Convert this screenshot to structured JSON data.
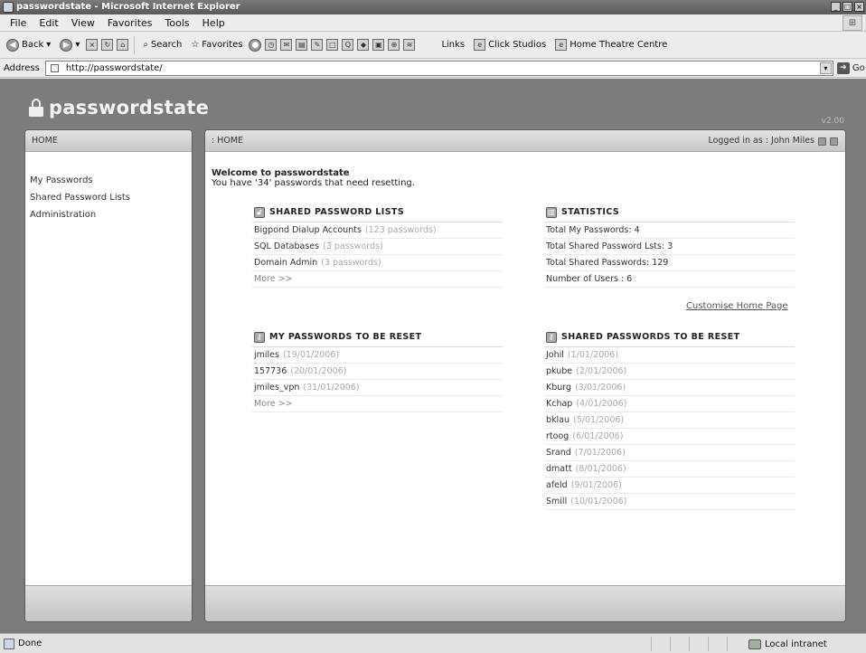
{
  "window": {
    "title": "passwordstate - Microsoft Internet Explorer",
    "controls": [
      "_",
      "□",
      "×"
    ]
  },
  "menu": [
    "File",
    "Edit",
    "View",
    "Favorites",
    "Tools",
    "Help"
  ],
  "toolbar": {
    "back": "Back",
    "search": "Search",
    "favorites": "Favorites",
    "links": "Links",
    "link1": "Click Studios",
    "link2": "Home Theatre Centre"
  },
  "address": {
    "label": "Address",
    "url": "http://passwordstate/",
    "go": "Go"
  },
  "app": {
    "brand": "passwordstate",
    "version": "v2.00"
  },
  "sidebar": {
    "header": "HOME",
    "items": [
      "My Passwords",
      "Shared Password Lists",
      "Administration"
    ]
  },
  "main": {
    "breadcrumb": ": HOME",
    "logged_in": "Logged in as : John Miles",
    "welcome_title": "Welcome to passwordstate",
    "welcome_text": "You have '34' passwords that need resetting.",
    "customise": "Customise Home Page",
    "more": "More >>"
  },
  "shared_lists": {
    "title": "SHARED PASSWORD LISTS",
    "items": [
      {
        "name": "Bigpond Dialup Accounts",
        "meta": "(123 passwords)"
      },
      {
        "name": "SQL Databases",
        "meta": "(3 passwords)"
      },
      {
        "name": "Domain Admin",
        "meta": "(3 passwords)"
      }
    ]
  },
  "statistics": {
    "title": "STATISTICS",
    "items": [
      "Total My Passwords: 4",
      "Total Shared Password Lsts: 3",
      "Total Shared Passwords: 129",
      "Number of Users : 6"
    ]
  },
  "my_reset": {
    "title": "MY PASSWORDS TO BE RESET",
    "items": [
      {
        "name": "jmiles",
        "date": "(19/01/2006)"
      },
      {
        "name": "157736",
        "date": "(20/01/2006)"
      },
      {
        "name": "jmiles_vpn",
        "date": "(31/01/2006)"
      }
    ]
  },
  "shared_reset": {
    "title": "SHARED PASSWORDS TO BE RESET",
    "items": [
      {
        "name": "Johil",
        "date": "(1/01/2006)"
      },
      {
        "name": "pkube",
        "date": "(2/01/2006)"
      },
      {
        "name": "Kburg",
        "date": "(3/01/2006)"
      },
      {
        "name": "Kchap",
        "date": "(4/01/2006)"
      },
      {
        "name": "bklau",
        "date": "(5/01/2006)"
      },
      {
        "name": "rtoog",
        "date": "(6/01/2006)"
      },
      {
        "name": "Srand",
        "date": "(7/01/2006)"
      },
      {
        "name": "dmatt",
        "date": "(8/01/2006)"
      },
      {
        "name": "afeld",
        "date": "(9/01/2006)"
      },
      {
        "name": "Smill",
        "date": "(10/01/2006)"
      }
    ]
  },
  "status": {
    "text": "Done",
    "zone": "Local intranet"
  }
}
